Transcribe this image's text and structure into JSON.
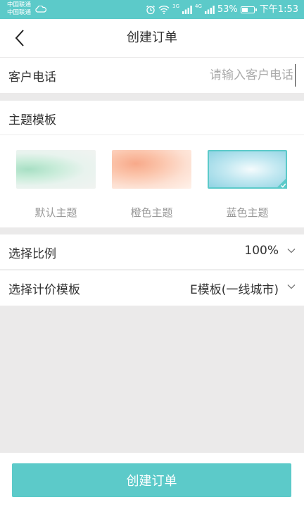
{
  "status_bar": {
    "carrier_1": "中国联通",
    "carrier_2": "中国联通",
    "signal_1_label": "3G",
    "signal_2_label": "4G",
    "battery": "53%",
    "battery_level": 0.53,
    "time": "下午1:53"
  },
  "nav": {
    "title": "创建订单"
  },
  "phone": {
    "label": "客户电话",
    "placeholder": "请输入客户电话",
    "value": ""
  },
  "theme": {
    "label": "主题模板",
    "options": [
      {
        "name": "默认主题",
        "selected": false
      },
      {
        "name": "橙色主题",
        "selected": false
      },
      {
        "name": "蓝色主题",
        "selected": true
      }
    ]
  },
  "ratio": {
    "label": "选择比例",
    "value": "100%"
  },
  "pricing": {
    "label": "选择计价模板",
    "value": "E模板(一线城市)"
  },
  "submit": {
    "label": "创建订单"
  },
  "colors": {
    "accent": "#5ccac9",
    "background": "#ebeaea"
  }
}
